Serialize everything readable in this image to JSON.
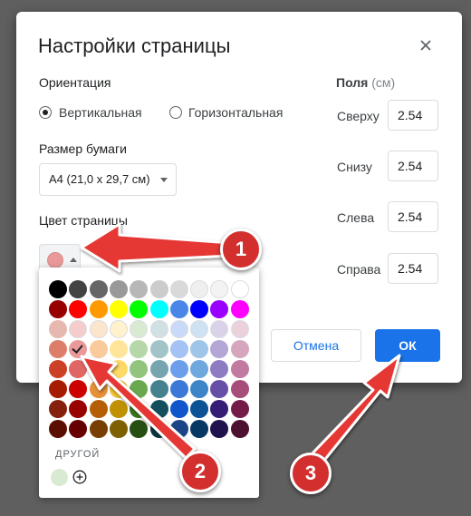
{
  "dialog": {
    "title": "Настройки страницы",
    "orientation": {
      "label": "Ориентация",
      "options": [
        {
          "label": "Вертикальная",
          "checked": true
        },
        {
          "label": "Горизонтальная",
          "checked": false
        }
      ]
    },
    "paper_size": {
      "label": "Размер бумаги",
      "value": "A4 (21,0 x 29,7 см)"
    },
    "page_color": {
      "label": "Цвет страницы",
      "selected": "#ea9999"
    },
    "margins": {
      "label": "Поля",
      "unit": "(см)",
      "fields": [
        {
          "label": "Сверху",
          "value": "2.54"
        },
        {
          "label": "Снизу",
          "value": "2.54"
        },
        {
          "label": "Слева",
          "value": "2.54"
        },
        {
          "label": "Справа",
          "value": "2.54"
        }
      ]
    },
    "buttons": {
      "cancel": "Отмена",
      "ok": "ОК"
    }
  },
  "palette": {
    "rows": [
      [
        "#000000",
        "#434343",
        "#666666",
        "#999999",
        "#b7b7b7",
        "#cccccc",
        "#d9d9d9",
        "#efefef",
        "#f3f3f3",
        "#ffffff"
      ],
      [
        "#980000",
        "#ff0000",
        "#ff9900",
        "#ffff00",
        "#00ff00",
        "#00ffff",
        "#4a86e8",
        "#0000ff",
        "#9900ff",
        "#ff00ff"
      ],
      [
        "#e6b8af",
        "#f4cccc",
        "#fce5cd",
        "#fff2cc",
        "#d9ead3",
        "#d0e0e3",
        "#c9daf8",
        "#cfe2f3",
        "#d9d2e9",
        "#ead1dc"
      ],
      [
        "#dd7e6b",
        "#ea9999",
        "#f9cb9c",
        "#ffe599",
        "#b6d7a8",
        "#a2c4c9",
        "#a4c2f4",
        "#9fc5e8",
        "#b4a7d6",
        "#d5a6bd"
      ],
      [
        "#cc4125",
        "#e06666",
        "#f6b26b",
        "#ffd966",
        "#93c47d",
        "#76a5af",
        "#6d9eeb",
        "#6fa8dc",
        "#8e7cc3",
        "#c27ba0"
      ],
      [
        "#a61c00",
        "#cc0000",
        "#e69138",
        "#f1c232",
        "#6aa84f",
        "#45818e",
        "#3c78d8",
        "#3d85c6",
        "#674ea7",
        "#a64d79"
      ],
      [
        "#85200c",
        "#990000",
        "#b45f06",
        "#bf9000",
        "#38761d",
        "#134f5c",
        "#1155cc",
        "#0b5394",
        "#351c75",
        "#741b47"
      ],
      [
        "#5b0f00",
        "#660000",
        "#783f04",
        "#7f6000",
        "#274e13",
        "#0c343d",
        "#1c4587",
        "#073763",
        "#20124d",
        "#4c1130"
      ]
    ],
    "selected_row": 3,
    "selected_col": 1,
    "custom_label": "ДРУГОЙ",
    "custom_colors": [
      "#d9ead3"
    ]
  },
  "callouts": {
    "arrow_color": "#e53935",
    "badges": [
      "1",
      "2",
      "3"
    ]
  }
}
